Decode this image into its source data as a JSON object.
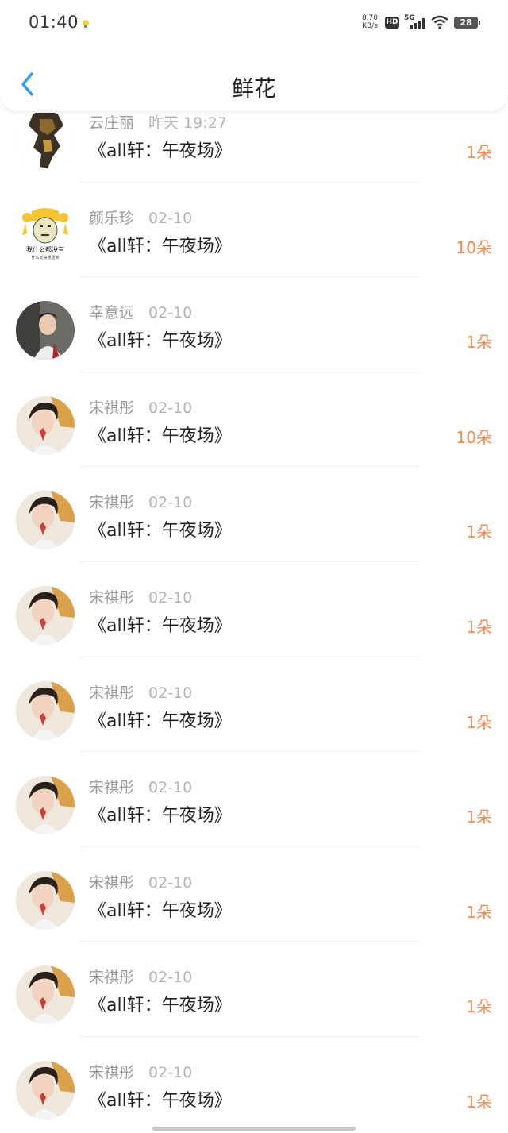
{
  "status_bar": {
    "time": "01:40",
    "net_speed_value": "8.70",
    "net_speed_unit": "KB/s",
    "hd": "HD",
    "network": "5G",
    "battery": "28"
  },
  "nav": {
    "title": "鲜花"
  },
  "rows": [
    {
      "name": "云庄丽",
      "date": "昨天 19:27",
      "title": "《all轩：午夜场》",
      "count": "1朵",
      "avatar": "robot"
    },
    {
      "name": "颜乐珍",
      "date": "02-10",
      "title": "《all轩：午夜场》",
      "count": "10朵",
      "avatar": "meme",
      "avatar_text_1": "我什么都没有",
      "avatar_text_2": "什么支撑我活到"
    },
    {
      "name": "幸意远",
      "date": "02-10",
      "title": "《all轩：午夜场》",
      "count": "1朵",
      "avatar": "boy"
    },
    {
      "name": "宋祺彤",
      "date": "02-10",
      "title": "《all轩：午夜场》",
      "count": "10朵",
      "avatar": "person"
    },
    {
      "name": "宋祺彤",
      "date": "02-10",
      "title": "《all轩：午夜场》",
      "count": "1朵",
      "avatar": "person"
    },
    {
      "name": "宋祺彤",
      "date": "02-10",
      "title": "《all轩：午夜场》",
      "count": "1朵",
      "avatar": "person"
    },
    {
      "name": "宋祺彤",
      "date": "02-10",
      "title": "《all轩：午夜场》",
      "count": "1朵",
      "avatar": "person"
    },
    {
      "name": "宋祺彤",
      "date": "02-10",
      "title": "《all轩：午夜场》",
      "count": "1朵",
      "avatar": "person"
    },
    {
      "name": "宋祺彤",
      "date": "02-10",
      "title": "《all轩：午夜场》",
      "count": "1朵",
      "avatar": "person"
    },
    {
      "name": "宋祺彤",
      "date": "02-10",
      "title": "《all轩：午夜场》",
      "count": "1朵",
      "avatar": "person"
    },
    {
      "name": "宋祺彤",
      "date": "02-10",
      "title": "《all轩：午夜场》",
      "count": "1朵",
      "avatar": "person"
    }
  ],
  "colors": {
    "accent": "#2a9df4",
    "count": "#f08a4b",
    "name": "#9a9a9a"
  },
  "icons": {
    "back": "chevron-left-icon"
  }
}
